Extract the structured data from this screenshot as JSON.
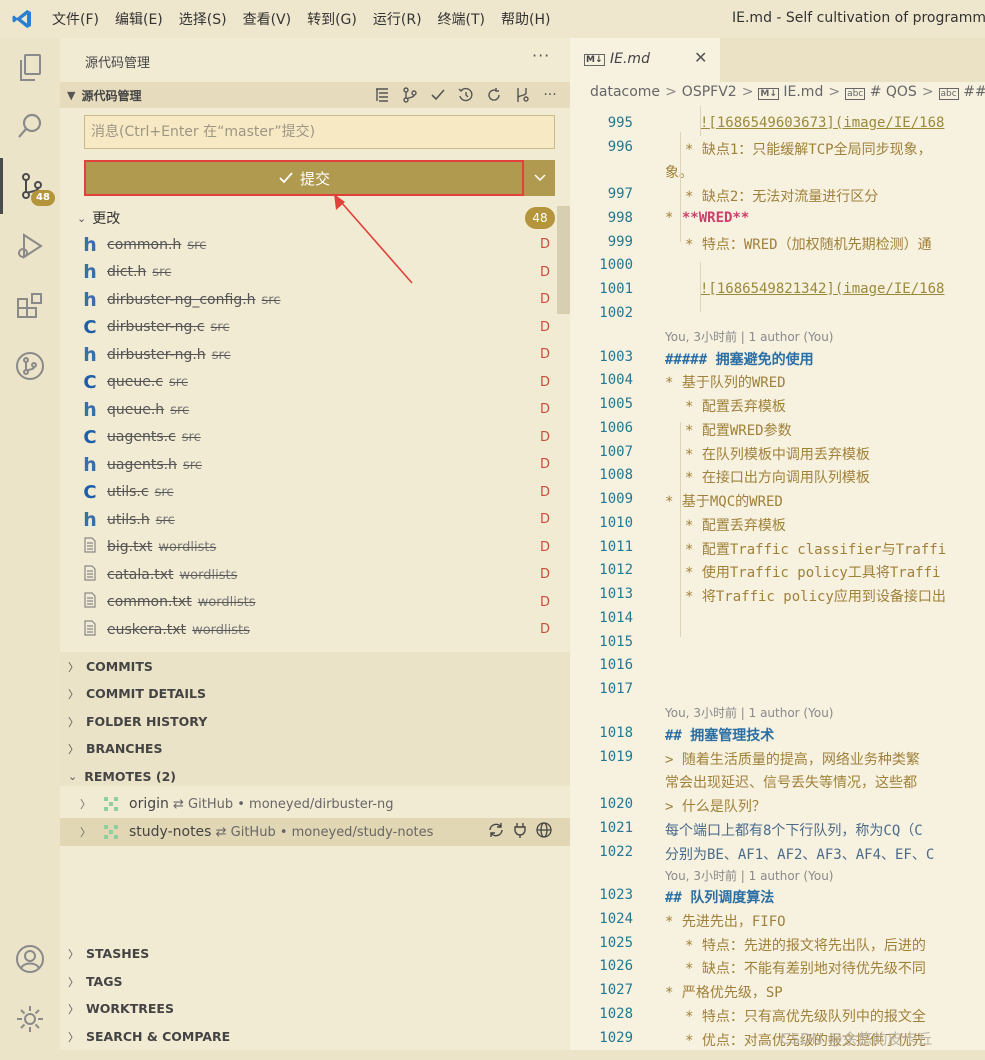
{
  "menu": {
    "items": [
      "文件(F)",
      "编辑(E)",
      "选择(S)",
      "查看(V)",
      "转到(G)",
      "运行(R)",
      "终端(T)",
      "帮助(H)"
    ],
    "window_title": "IE.md - Self cultivation of programmer"
  },
  "activity": {
    "badge": "48"
  },
  "sidebar": {
    "title": "源代码管理",
    "scm_label": "源代码管理",
    "message_placeholder": "消息(Ctrl+Enter 在“master”提交)",
    "commit_label": "提交",
    "changes_label": "更改",
    "changes_count": "48",
    "files": [
      {
        "icon": "h",
        "name": "common.h",
        "dir": "src",
        "status": "D"
      },
      {
        "icon": "h",
        "name": "dict.h",
        "dir": "src",
        "status": "D"
      },
      {
        "icon": "h",
        "name": "dirbuster-ng_config.h",
        "dir": "src",
        "status": "D"
      },
      {
        "icon": "C",
        "name": "dirbuster-ng.c",
        "dir": "src",
        "status": "D"
      },
      {
        "icon": "h",
        "name": "dirbuster-ng.h",
        "dir": "src",
        "status": "D"
      },
      {
        "icon": "C",
        "name": "queue.c",
        "dir": "src",
        "status": "D"
      },
      {
        "icon": "h",
        "name": "queue.h",
        "dir": "src",
        "status": "D"
      },
      {
        "icon": "C",
        "name": "uagents.c",
        "dir": "src",
        "status": "D"
      },
      {
        "icon": "h",
        "name": "uagents.h",
        "dir": "src",
        "status": "D"
      },
      {
        "icon": "C",
        "name": "utils.c",
        "dir": "src",
        "status": "D"
      },
      {
        "icon": "h",
        "name": "utils.h",
        "dir": "src",
        "status": "D"
      },
      {
        "icon": "txt",
        "name": "big.txt",
        "dir": "wordlists",
        "status": "D"
      },
      {
        "icon": "txt",
        "name": "catala.txt",
        "dir": "wordlists",
        "status": "D"
      },
      {
        "icon": "txt",
        "name": "common.txt",
        "dir": "wordlists",
        "status": "D"
      },
      {
        "icon": "txt",
        "name": "euskera.txt",
        "dir": "wordlists",
        "status": "D"
      }
    ],
    "sections_top": [
      "COMMITS",
      "COMMIT DETAILS",
      "FOLDER HISTORY",
      "BRANCHES"
    ],
    "remotes_label": "REMOTES (2)",
    "remotes": [
      {
        "name": "origin",
        "provider": "GitHub",
        "repo": "moneyed/dirbuster-ng"
      },
      {
        "name": "study-notes",
        "provider": "GitHub",
        "repo": "moneyed/study-notes"
      }
    ],
    "sections_bottom": [
      "STASHES",
      "TAGS",
      "WORKTREES",
      "SEARCH & COMPARE"
    ]
  },
  "editor": {
    "tab_label": "IE.md",
    "breadcrumbs": [
      "datacome",
      "OSPFV2",
      "IE.md",
      "# QOS",
      "##"
    ],
    "blame": "You, 3小时前 | 1 author (You)",
    "lines": {
      "995": "![1686549603673](image/IE/168",
      "996a": "* 缺点1：只能缓解TCP全局同步现象，",
      "996b": "象。",
      "997": "* 缺点2：无法对流量进行区分",
      "998": "**WRED**",
      "999": "* 特点：WRED（加权随机先期检测）通",
      "1001": "![1686549821342](image/IE/168",
      "1003": "##### 拥塞避免的使用",
      "1004": "* 基于队列的WRED",
      "1005": "* 配置丢弃模板",
      "1006": "* 配置WRED参数",
      "1007": "* 在队列模板中调用丢弃模板",
      "1008": "* 在接口出方向调用队列模板",
      "1009": "* 基于MQC的WRED",
      "1010": "* 配置丢弃模板",
      "1011": "* 配置Traffic classifier与Traffi",
      "1012": "* 使用Traffic policy工具将Traffi",
      "1013": "* 将Traffic policy应用到设备接口出",
      "1018": "## 拥塞管理技术",
      "1019a": "> 随着生活质量的提高，网络业务种类繁",
      "1019b": "常会出现延迟、信号丢失等情况，这些都",
      "1020": "> 什么是队列？",
      "1021": "每个端口上都有8个下行队列，称为CQ（C",
      "1022": "分别为BE、AF1、AF2、AF3、AF4、EF、C",
      "1023": "## 队列调度算法",
      "1024": "* 先进先出，FIFO",
      "1025": "* 特点：先进的报文将先出队，后进的",
      "1026": "* 缺点：不能有差别地对待优先级不同",
      "1027": "* 严格优先级，SP",
      "1028": "* 特点：只有高优先级队列中的报文全",
      "1029": "* 优点：对高优先级的报文提供了优先"
    }
  },
  "watermark": "CSDN @余悠的皮卡丘"
}
